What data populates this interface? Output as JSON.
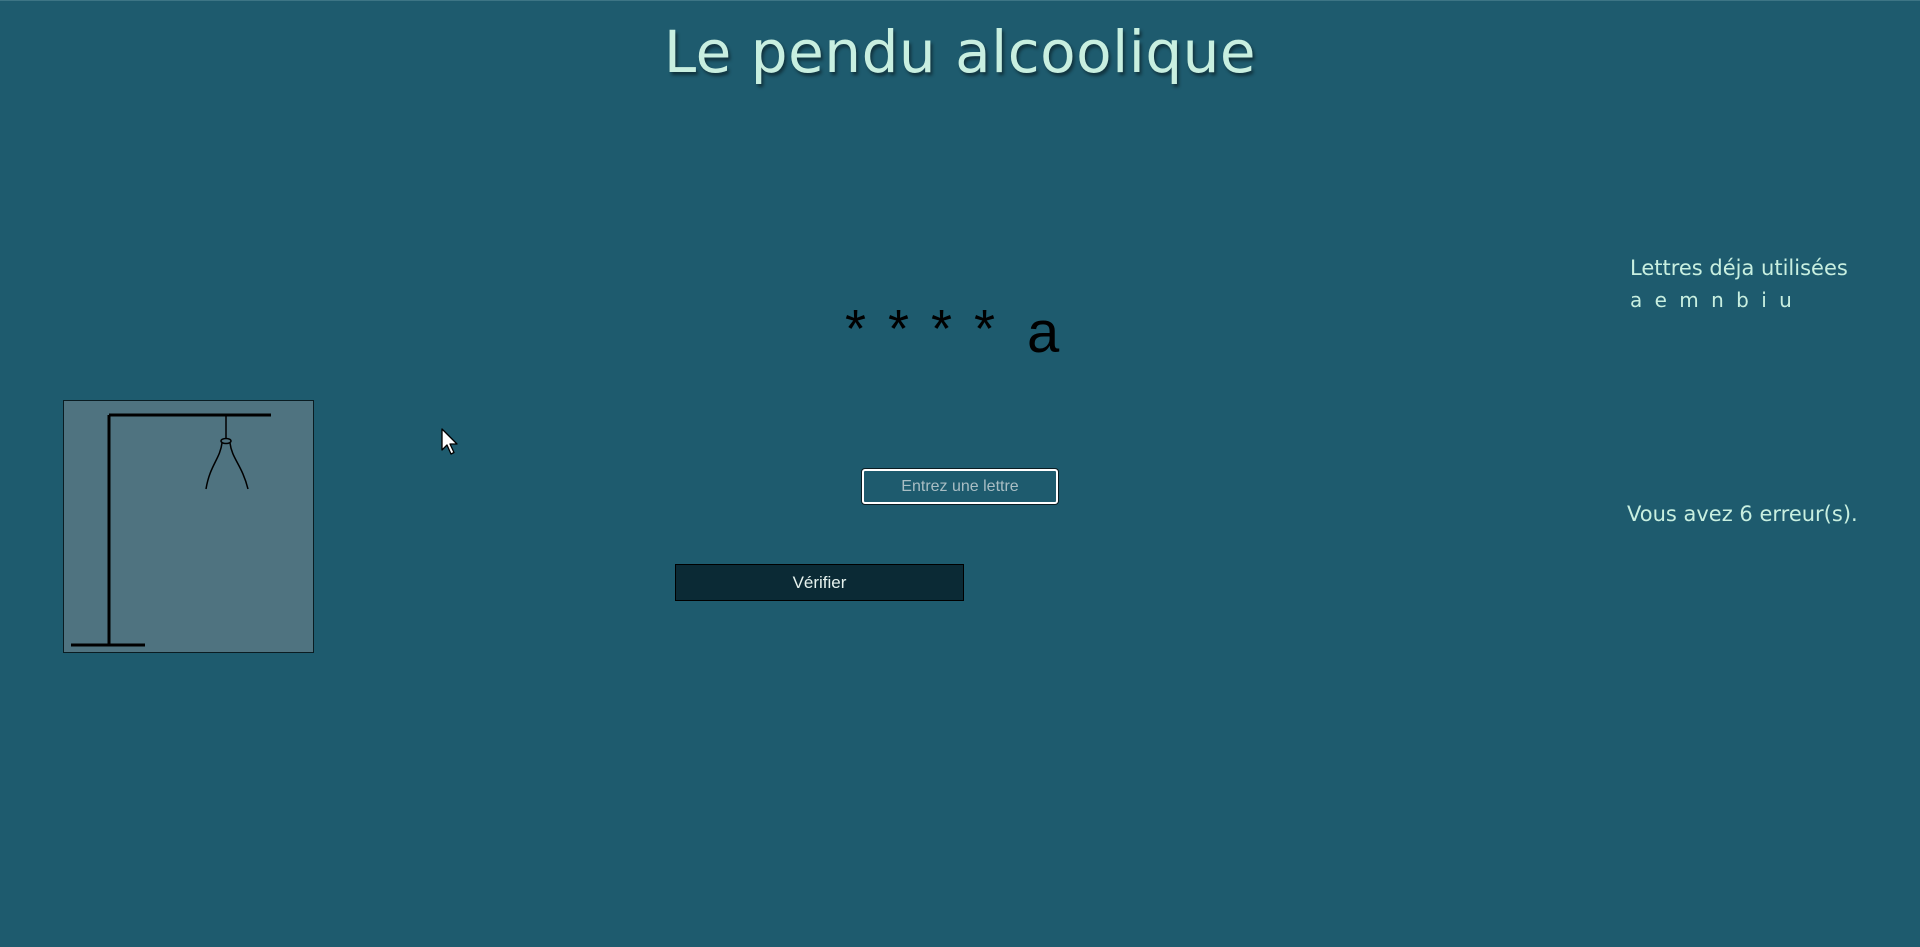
{
  "page": {
    "title": "Le pendu alcoolique"
  },
  "game": {
    "masked_word": [
      "*",
      "*",
      "*",
      "*",
      "a"
    ],
    "input_placeholder": "Entrez une lettre",
    "input_value": "",
    "verify_label": "Vérifier"
  },
  "status": {
    "used_letters_heading": "Lettres déja utilisées",
    "used_letters": "a e m n b i u",
    "errors_text": "Vous avez 6 erreur(s)."
  },
  "colors": {
    "background": "#1e5b6e",
    "title_text": "#c8efe0",
    "hangman_panel": "#4f7380",
    "button_background": "#0b2a35"
  }
}
